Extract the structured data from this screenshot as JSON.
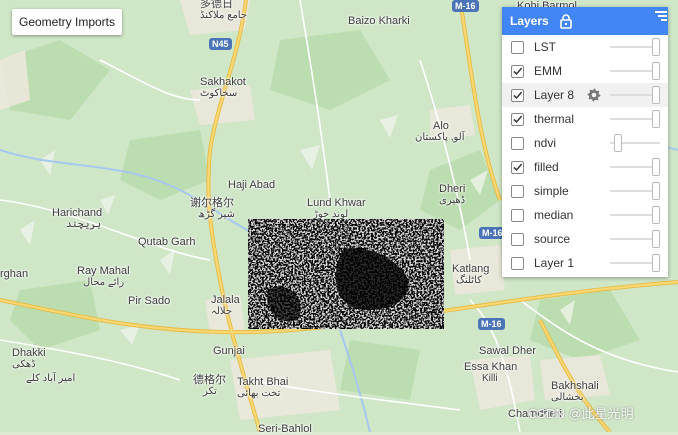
{
  "geometry_imports": {
    "label": "Geometry Imports"
  },
  "layers_panel": {
    "title": "Layers",
    "items": [
      {
        "label": "LST",
        "checked": false,
        "opacity": 1.0,
        "active": false
      },
      {
        "label": "EMM",
        "checked": true,
        "opacity": 1.0,
        "active": false
      },
      {
        "label": "Layer 8",
        "checked": true,
        "opacity": 1.0,
        "active": true
      },
      {
        "label": "thermal",
        "checked": true,
        "opacity": 1.0,
        "active": false
      },
      {
        "label": "ndvi",
        "checked": false,
        "opacity": 0.1,
        "active": false
      },
      {
        "label": "filled",
        "checked": true,
        "opacity": 1.0,
        "active": false
      },
      {
        "label": "simple",
        "checked": false,
        "opacity": 1.0,
        "active": false
      },
      {
        "label": "median",
        "checked": false,
        "opacity": 1.0,
        "active": false
      },
      {
        "label": "source",
        "checked": false,
        "opacity": 1.0,
        "active": false
      },
      {
        "label": "Layer 1",
        "checked": false,
        "opacity": 1.0,
        "active": false
      }
    ]
  },
  "map": {
    "roads": {
      "n45": "N45",
      "m16_top": "M-16",
      "m16_right": "M-16",
      "m16_bottom": "M-16"
    },
    "places": {
      "kohi_barmol": {
        "name": "Kohi Barmol",
        "local": ""
      },
      "baizo_kharki": {
        "name": "Baizo Kharki",
        "local": ""
      },
      "top_local": {
        "name": "多德日",
        "local": "جامع ملاکنڈ"
      },
      "sakhakot": {
        "name": "Sakhakot",
        "local": "سخاکوٹ"
      },
      "alo": {
        "name": "Alo",
        "local": "آلو, پاکستان"
      },
      "haji_abad": {
        "name": "Haji Abad",
        "local": ""
      },
      "lund_khwar": {
        "name": "Lund Khwar",
        "local": "لوند خوڑ"
      },
      "dheri": {
        "name": "Dheri",
        "local": "ڈھیری"
      },
      "harichand": {
        "name": "Harichand",
        "local": "ہریچند"
      },
      "shergarh": {
        "name": "谢尔格尔",
        "local": "شیر گڑھ"
      },
      "qutab_garh": {
        "name": "Qutab Garh",
        "local": ""
      },
      "arghan": {
        "name": "rghan",
        "local": ""
      },
      "ray_mahal": {
        "name": "Ray Mahal",
        "local": "رائے محال"
      },
      "katlang": {
        "name": "Katlang",
        "local": "کاٹلنگ"
      },
      "pir_sado": {
        "name": "Pir Sado",
        "local": ""
      },
      "jalala": {
        "name": "Jalala",
        "local": "جلالہ"
      },
      "gunjai": {
        "name": "Gunjai",
        "local": ""
      },
      "sawal_dher": {
        "name": "Sawal Dher",
        "local": ""
      },
      "dhakki": {
        "name": "Dhakki",
        "local": "ڈھکی"
      },
      "amirabad": {
        "name": "",
        "local": "امیر آباد کلے"
      },
      "takkar": {
        "name": "德格尔",
        "local": "تکر"
      },
      "takht_bhai": {
        "name": "Takht Bhai",
        "local": "تخت بھائی"
      },
      "essa_khan": {
        "name": "Essa Khan",
        "local": "Killi"
      },
      "bakhshali": {
        "name": "Bakhshali",
        "local": "بخشالی"
      },
      "chamdheri": {
        "name": "Chamdheri",
        "local": ""
      },
      "seri_bahlol": {
        "name": "Seri-Bahlol",
        "local": ""
      }
    }
  },
  "watermark": "CSDN @此星光明",
  "colors": {
    "header": "#4285f4",
    "road_major": "#f6c94a",
    "map_bg": "#dcebd4"
  }
}
